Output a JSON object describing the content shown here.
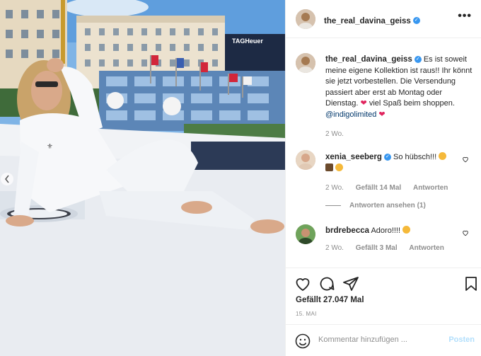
{
  "post": {
    "author": "the_real_davina_geiss",
    "caption_parts": {
      "line1": "Es ist soweit meine eigene Kollektion ist raus!! Ihr könnt sie jetzt vorbestellen. Die Versendung passiert aber erst ab Montag oder Dienstag.",
      "after_heart": " viel Spaß beim shoppen. ",
      "mention": "@indigolimited"
    },
    "caption_time": "2 Wo.",
    "billboard_text": "TAGHeuer"
  },
  "comments": [
    {
      "user": "xenia_seeberg",
      "text": "So hübsch!!!",
      "time": "2 Wo.",
      "likes": "Gefällt 14 Mal",
      "reply": "Antworten",
      "view_replies": "Antworten ansehen (1)"
    },
    {
      "user": "brdrebecca",
      "text": "Adoro!!!!",
      "time": "2 Wo.",
      "likes": "Gefällt 3 Mal",
      "reply": "Antworten"
    }
  ],
  "actions": {
    "likes_label": "Gefällt 27.047 Mal",
    "date": "15. MAI"
  },
  "add_comment": {
    "placeholder": "Kommentar hinzufügen ...",
    "post_label": "Posten"
  },
  "colors": {
    "verified": "#3897f0",
    "link": "#00376b",
    "muted": "#8e8e8e",
    "post_disabled": "#b2dffc",
    "red_heart": "#e0245e"
  },
  "icons": [
    "more-options-icon",
    "verified-icon",
    "heart-icon",
    "comment-icon",
    "share-icon",
    "bookmark-icon",
    "emoji-icon"
  ]
}
